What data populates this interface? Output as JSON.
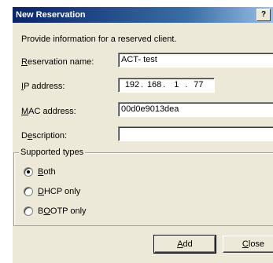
{
  "window": {
    "title": "New Reservation",
    "help_label": "?"
  },
  "intro": "Provide information for a reserved client.",
  "fields": {
    "reservation_name": {
      "label_accel": "R",
      "label_rest": "eservation name:",
      "value": "ACT- test"
    },
    "ip_address": {
      "label_accel": "I",
      "label_rest": "P address:",
      "octets": [
        "192",
        "168",
        "1",
        "77"
      ],
      "sep": "."
    },
    "mac_address": {
      "label_accel": "M",
      "label_rest": "AC address:",
      "value": "00d0e9013dea"
    },
    "description": {
      "label_pre": "D",
      "label_accel": "e",
      "label_rest": "scription:",
      "value": ""
    }
  },
  "supported_types": {
    "legend": "Supported types",
    "options": [
      {
        "accel": "B",
        "rest": "oth",
        "pre": "",
        "selected": true
      },
      {
        "accel": "D",
        "rest": "HCP only",
        "pre": "",
        "selected": false
      },
      {
        "pre": "B",
        "accel": "O",
        "rest": "OTP only",
        "selected": false
      }
    ]
  },
  "buttons": {
    "add": {
      "accel": "A",
      "rest": "dd"
    },
    "close": {
      "accel": "C",
      "rest": "lose"
    }
  }
}
